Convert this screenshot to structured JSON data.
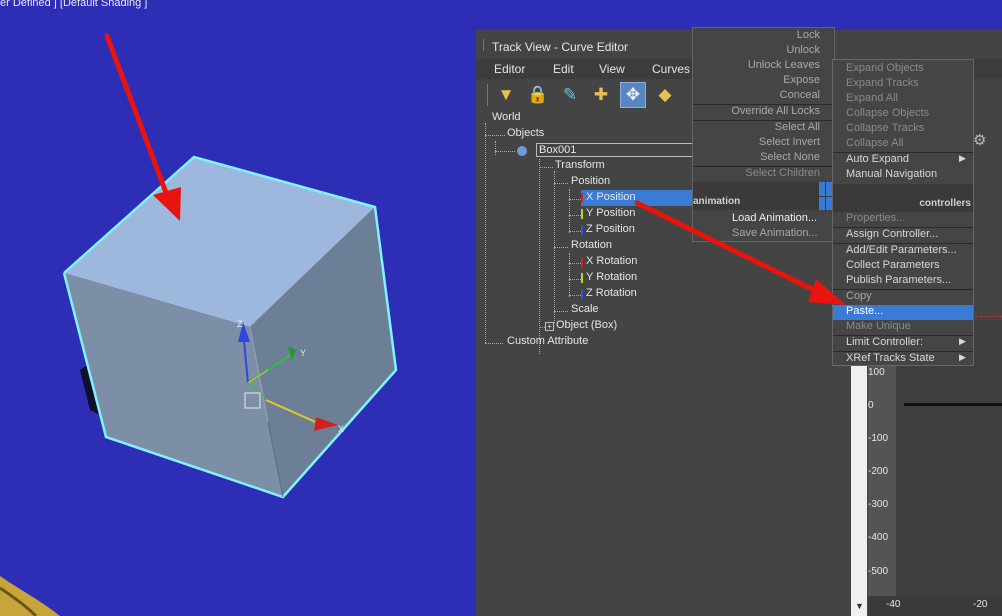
{
  "viewport": {
    "label": "er Defined ] [Default Shading ]",
    "gizmo": {
      "x": "X",
      "y": "Y",
      "z": "Z"
    }
  },
  "trackview": {
    "title": "Track View - Curve Editor",
    "menus": [
      "Editor",
      "Edit",
      "View",
      "Curves"
    ],
    "tree": {
      "world": "World",
      "objects": "Objects",
      "box": "Box001",
      "transform": "Transform",
      "position": "Position",
      "x_position": "X Position",
      "y_position": "Y Position",
      "z_position": "Z Position",
      "rotation": "Rotation",
      "x_rotation": "X Rotation",
      "y_rotation": "Y Rotation",
      "z_rotation": "Z Rotation",
      "scale": "Scale",
      "object_box": "Object (Box)",
      "custom_attr": "Custom Attribute"
    },
    "graph": {
      "y_ticks": [
        "100",
        "0",
        "-100",
        "-200",
        "-300",
        "-400",
        "-500"
      ],
      "x_ticks": [
        "-40",
        "-20"
      ]
    }
  },
  "menu_left": {
    "items": [
      "Lock",
      "Unlock",
      "Unlock Leaves",
      "Expose",
      "Conceal",
      "Override All Locks",
      "Select All",
      "Select Invert",
      "Select None",
      "Select Children"
    ],
    "header_animation": "animation",
    "items2": [
      "Load Animation...",
      "Save Animation..."
    ]
  },
  "menu_right": {
    "items_disabled_top": [
      "Expand Objects",
      "Expand Tracks",
      "Expand All",
      "Collapse Objects",
      "Collapse Tracks",
      "Collapse All"
    ],
    "auto_expand": "Auto Expand",
    "manual_navigation": "Manual Navigation",
    "header_controllers": "controllers",
    "properties": "Properties...",
    "assign_controller": "Assign Controller...",
    "add_edit_parameters": "Add/Edit Parameters...",
    "collect_parameters": "Collect Parameters",
    "publish_parameters": "Publish Parameters...",
    "copy": "Copy",
    "paste": "Paste...",
    "make_unique": "Make Unique",
    "limit_controller": "Limit Controller:",
    "xref_tracks_state": "XRef Tracks State"
  },
  "colors": {
    "highlight": "#3a7bd5",
    "annotation_arrow": "#e8140e",
    "viewport_bg": "#2e2db5"
  }
}
